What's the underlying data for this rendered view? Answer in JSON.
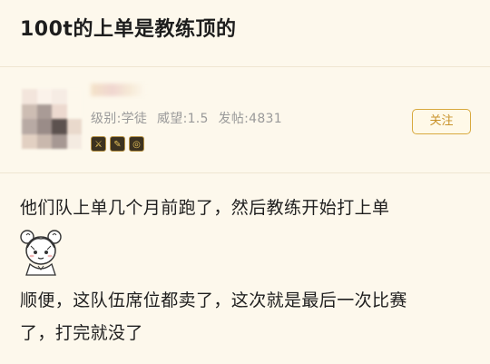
{
  "post": {
    "title": "100t的上单是教练顶的"
  },
  "author": {
    "level_label": "级别:学徒",
    "prestige_label": "威望:1.5",
    "posts_label": "发帖:4831",
    "follow_label": "关注",
    "badge_icons": [
      "rank-badge-icon",
      "feather-badge-icon",
      "target-badge-icon"
    ]
  },
  "content": {
    "lines": [
      "他们队上单几个月前跑了，然后教练开始打上单",
      "顺便，这队伍席位都卖了，这次就是最后一次比赛",
      "了，打完就没了"
    ]
  },
  "colors": {
    "background": "#fdf8ec",
    "accent": "#c8922a",
    "meta_text": "#9a9a9a"
  }
}
